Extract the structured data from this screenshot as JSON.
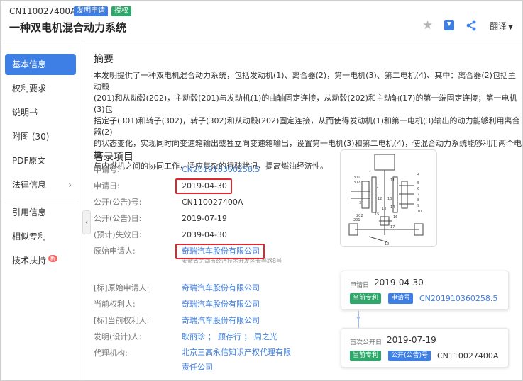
{
  "header": {
    "pub_number": "CN110027400A",
    "tag_application": "发明申请",
    "tag_granted": "授权",
    "title": "一种双电机混合动力系统",
    "translate_label": "翻译"
  },
  "sidebar": {
    "items": [
      {
        "label": "基本信息",
        "active": true
      },
      {
        "label": "权利要求"
      },
      {
        "label": "说明书"
      },
      {
        "label": "附图 (30)"
      },
      {
        "label": "PDF原文"
      },
      {
        "label": "法律信息"
      },
      {
        "label": "引用信息"
      },
      {
        "label": "相似专利"
      },
      {
        "label": "技术扶持"
      }
    ],
    "new_badge": "新",
    "expand_arrow": "›",
    "collapse_arrow": "‹"
  },
  "abstract": {
    "heading": "摘要",
    "text": "本发明提供了一种双电机混合动力系统，包括发动机(1)、离合器(2)，第一电机(3)、第二电机(4)、其中：离合器(2)包括主动毂\n(201)和从动毂(202)，主动毂(201)与发动机(1)的曲轴固定连接，从动毂(202)和主动轴(17)的第一端固定连接；第一电机(3)包\n括定子(301)和转子(302)，转子(302)和从动毂(202)固定连接，从而使得发动机(1)和第一电机(3)输出的动力能够利用离合器(2)\n的状态变化，实现同时向变速箱输出或独立向变速箱输出，设置第一电机(3)和第二电机(4)，使混合动力系统能够利用两个电机\n与内燃机之间的协同工作，适应复杂的行驶状况，提高燃油经济性。"
  },
  "biblio": {
    "heading": "著录项目",
    "rows": [
      {
        "label": "申请号:",
        "value": "CN201910360258.5"
      },
      {
        "label": "申请日:",
        "value": "2019-04-30"
      },
      {
        "label": "公开(公告)号:",
        "value": "CN110027400A"
      },
      {
        "label": "公开(公告)日:",
        "value": "2019-07-19"
      },
      {
        "label": "(预计)失效日:",
        "value": "2039-04-30"
      },
      {
        "label": "原始申请人:",
        "value": "奇瑞汽车股份有限公司"
      },
      {
        "label": "[标]原始申请人:",
        "value": "奇瑞汽车股份有限公司"
      },
      {
        "label": "当前权利人:",
        "value": "奇瑞汽车股份有限公司"
      },
      {
        "label": "[标]当前权利人:",
        "value": "奇瑞汽车股份有限公司"
      },
      {
        "label": "发明(设计)人:",
        "value": "耿丽珍 ； 顾存行 ； 周之光"
      },
      {
        "label": "代理机构:",
        "value": "北京三高永信知识产权代理有限责任公司"
      }
    ],
    "applicant_address": "安徽省芜湖市经济技术开发区长春路8号"
  },
  "timeline": {
    "card1": {
      "label": "申请日",
      "date": "2019-04-30",
      "pill1": "当前专利",
      "pill2": "申请号",
      "value": "CN201910360258.5"
    },
    "card2": {
      "label": "首次公开日",
      "date": "2019-07-19",
      "pill1": "当前专利",
      "pill2": "公开(公告)号",
      "value": "CN110027400A"
    }
  },
  "drawing": {
    "labels": [
      "301",
      "302",
      "202",
      "201",
      "1",
      "2",
      "3",
      "4",
      "5",
      "6",
      "7",
      "8",
      "9",
      "10",
      "11",
      "12",
      "13",
      "14",
      "15",
      "16",
      "17",
      "18",
      "19"
    ]
  },
  "colors": {
    "accent": "#3d7fe5",
    "green": "#2ea86a",
    "highlight": "#e0262e"
  }
}
